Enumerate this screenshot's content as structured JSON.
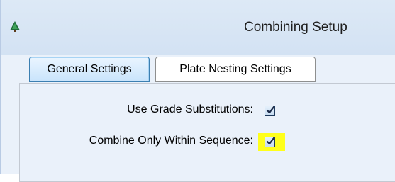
{
  "window": {
    "title": "Combining Setup",
    "icon": "tree-app-icon"
  },
  "tabs": [
    {
      "label": "General Settings",
      "active": true
    },
    {
      "label": "Plate Nesting Settings",
      "active": false
    }
  ],
  "general": {
    "use_grade_substitutions": {
      "label": "Use Grade Substitutions:",
      "checked": true
    },
    "combine_within_sequence": {
      "label": "Combine Only Within Sequence:",
      "checked": true,
      "highlight_color": "#ffff1a"
    }
  },
  "colors": {
    "window_bg": "#eaf1fa",
    "titlebar_bg": "#d3e2f3",
    "active_tab_border": "#3c7fb1"
  }
}
